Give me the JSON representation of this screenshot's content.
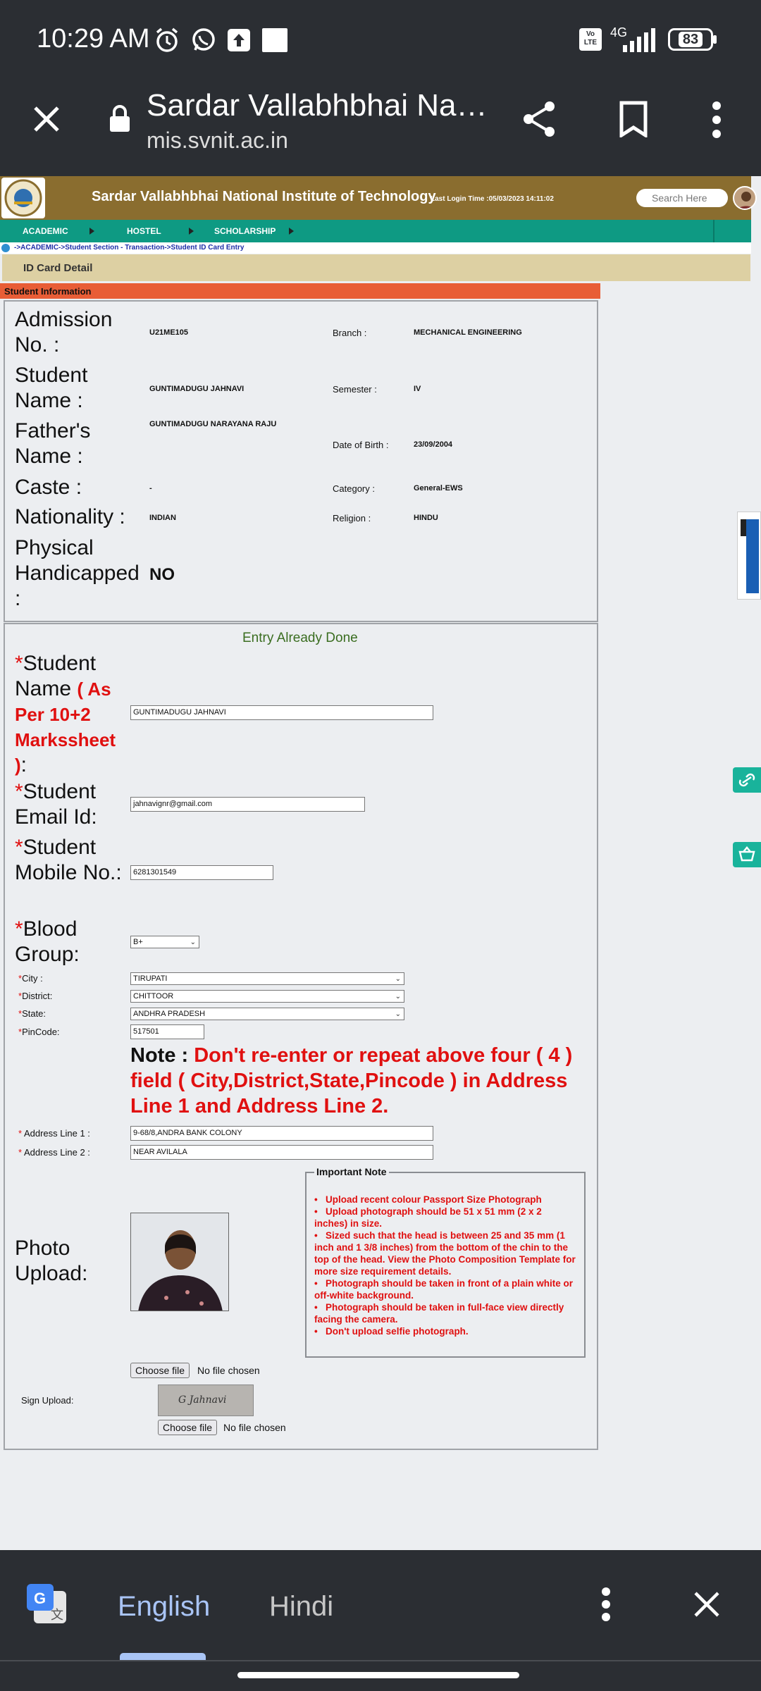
{
  "status": {
    "time": "10:29 AM",
    "network": "4G",
    "volte": "Vo\nLTE",
    "battery": "83"
  },
  "browser": {
    "title": "Sardar Vallabhbhai Na…",
    "url": "mis.svnit.ac.in"
  },
  "site": {
    "title": "Sardar Vallabhbhai National Institute of Technology",
    "last_login": "Last Login Time :05/03/2023 14:11:02",
    "search_placeholder": "Search Here",
    "nav": [
      "ACADEMIC",
      "HOSTEL",
      "SCHOLARSHIP"
    ],
    "breadcrumb": "->ACADEMIC->Student Section - Transaction->Student ID Card Entry",
    "section_title": "ID Card Detail",
    "info_header": "Student Information"
  },
  "info": {
    "admission_label": "Admission No. :",
    "admission": "U21ME105",
    "branch_label": "Branch :",
    "branch": "MECHANICAL ENGINEERING",
    "name_label": "Student Name :",
    "name": "GUNTIMADUGU JAHNAVI",
    "semester_label": "Semester :",
    "semester": "IV",
    "father_label": "Father's Name :",
    "father": "GUNTIMADUGU NARAYANA RAJU",
    "dob_label": "Date of Birth :",
    "dob": "23/09/2004",
    "caste_label": "Caste :",
    "caste": "-",
    "category_label": "Category :",
    "category": "General-EWS",
    "nationality_label": "Nationality :",
    "nationality": "INDIAN",
    "religion_label": "Religion :",
    "religion": "HINDU",
    "ph_label": "Physical Handicapped :",
    "ph": "NO"
  },
  "form": {
    "entry_status": "Entry Already Done",
    "star": "*",
    "name_label": "Student Name",
    "name_note": "( As Per 10+2 Markssheet )",
    "name_colon": ":",
    "name_value": "GUNTIMADUGU JAHNAVI",
    "email_label": "Student Email Id:",
    "email_value": "jahnavignr@gmail.com",
    "mobile_label": "Student Mobile No.:",
    "mobile_value": "6281301549",
    "blood_label": "Blood Group:",
    "blood_value": "B+",
    "city_label": "City :",
    "city_value": "TIRUPATI",
    "district_label": "District:",
    "district_value": "CHITTOOR",
    "state_label": "State:",
    "state_value": "ANDHRA PRADESH",
    "pin_label": "PinCode:",
    "pin_value": "517501",
    "note_label": "Note :",
    "note_text": "Don't re-enter or repeat above four ( 4 ) field ( City,District,State,Pincode ) in Address Line 1 and Address Line 2.",
    "addr1_label": "Address Line 1 :",
    "addr1_value": "9-68/8,ANDRA BANK COLONY",
    "addr2_label": "Address Line 2 :",
    "addr2_value": "NEAR AVILALA",
    "photo_label": "Photo Upload:",
    "important_title": "Important Note",
    "important_items": [
      "Upload recent colour Passport Size Photograph",
      "Upload photograph should be 51 x 51 mm (2 x 2 inches) in size.",
      "Sized such that the head is between 25 and 35 mm (1 inch and 1 3/8 inches) from the bottom of the chin to the top of the head. View the Photo Composition Template for more size requirement details.",
      "Photograph should be taken in front of a plain white or off-white background.",
      "Photograph should be taken in full-face view directly facing the camera.",
      "Don't upload selfie photograph."
    ],
    "choose_file": "Choose file",
    "no_file": "No file chosen",
    "sign_label": "Sign Upload:",
    "signature_text": "G Jahnavi"
  },
  "translate": {
    "lang1": "English",
    "lang2": "Hindi"
  },
  "colors": {
    "header": "#8a6d2f",
    "nav": "#0e9a83",
    "tan": "#ddd0a3",
    "orange": "#e85d36",
    "required": "#e01010",
    "chrome": "#2b2e33"
  }
}
